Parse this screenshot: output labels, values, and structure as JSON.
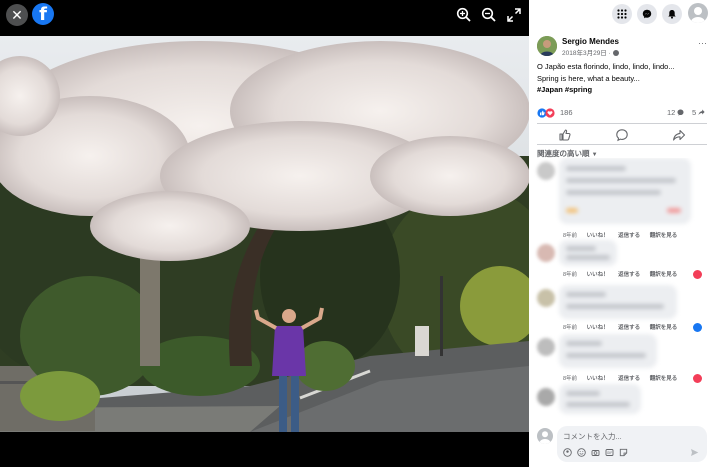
{
  "colors": {
    "brand": "#1877f2",
    "like": "#1877f2",
    "love": "#f33e58"
  },
  "viewer": {
    "close_icon": "close-icon",
    "logo_icon": "facebook-logo",
    "tools": [
      "zoom-in-icon",
      "zoom-out-icon",
      "fullscreen-icon"
    ]
  },
  "header": {
    "buttons": [
      "menu-grid-icon",
      "messenger-icon",
      "bell-icon",
      "account-icon"
    ]
  },
  "post": {
    "author": "Sergio Mendes",
    "date": "2018年3月29日 · ",
    "caption_line1": "O Japão esta florindo, lindo, lindo, lindo...",
    "caption_line2": "Spring is here, what a beauty...",
    "hashtags": "#Japan #spring",
    "more": "···"
  },
  "stats": {
    "reactions": "186",
    "comments": "12",
    "shares": "5"
  },
  "actions": [
    "like-icon",
    "comment-icon",
    "share-icon"
  ],
  "comments_sort": "関連度の高い順",
  "comment_meta": {
    "time": "8年前",
    "like": "いいね！",
    "reply": "返信する",
    "translate": "翻訳を見る"
  },
  "composer": {
    "placeholder": "コメントを入力..."
  }
}
